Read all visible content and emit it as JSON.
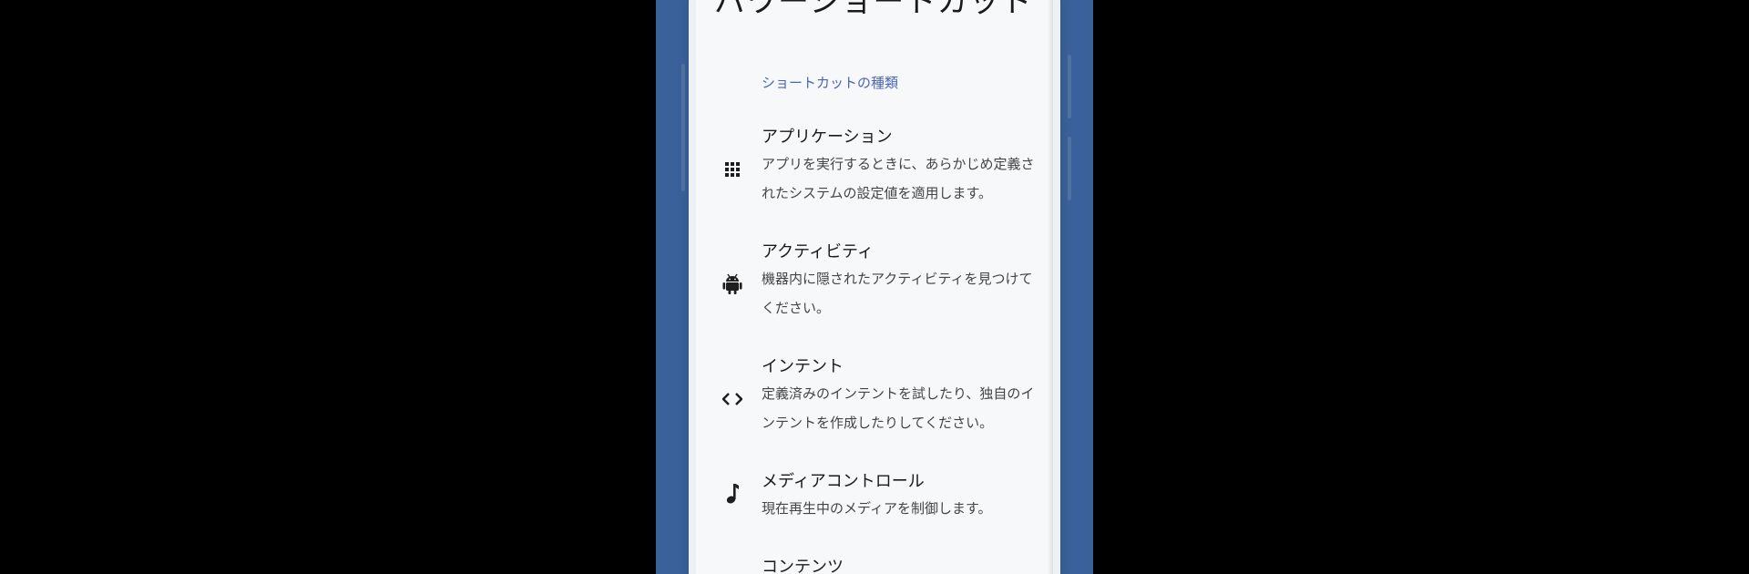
{
  "page": {
    "title": "パワーショートカット"
  },
  "section": {
    "header": "ショートカットの種類"
  },
  "items": [
    {
      "icon": "apps-grid-icon",
      "title": "アプリケーション",
      "description": "アプリを実行するときに、あらかじめ定義されたシステムの設定値を適用します。"
    },
    {
      "icon": "android-icon",
      "title": "アクティビティ",
      "description": "機器内に隠されたアクティビティを見つけてください。"
    },
    {
      "icon": "code-icon",
      "title": "インテント",
      "description": "定義済みのインテントを試したり、独自のインテントを作成したりしてください。"
    },
    {
      "icon": "music-note-icon",
      "title": "メディアコントロール",
      "description": "現在再生中のメディアを制御します。"
    },
    {
      "icon": "",
      "title": "コンテンツ",
      "description": ""
    }
  ],
  "colors": {
    "background": "#000000",
    "frame": "#3a6199",
    "screen": "#f7f8f9",
    "accent": "#4a63b8",
    "title_text": "#1a1a1a",
    "desc_text": "#444444"
  }
}
